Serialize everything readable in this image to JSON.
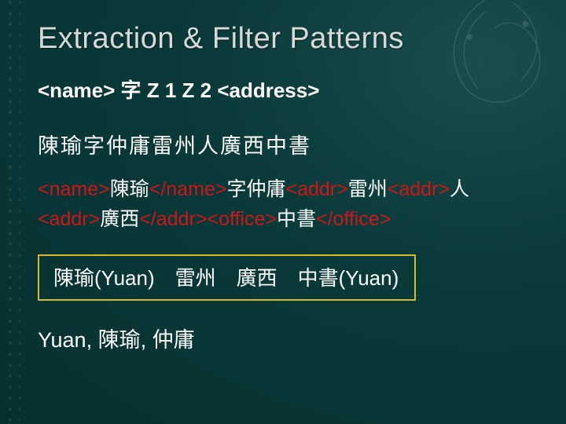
{
  "title": "Extraction & Filter Patterns",
  "pattern": "<name> 字 Z 1 Z 2 <address>",
  "example_source": "陳瑜字仲庸雷州人廣西中書",
  "tagged": {
    "p1_tag": "<name>",
    "p1_txt": "陳瑜",
    "p2_tag": "</name>",
    "p3_txt": "字仲庸",
    "p4_tag": "<addr>",
    "p5_txt": "雷州",
    "p6_tag": "<addr>",
    "p7_txt": "人",
    "p8_tag": "<addr>",
    "p9_txt": "廣西",
    "p10_tag": "</addr><office>",
    "p11_txt": "中書",
    "p12_tag": "</office>"
  },
  "boxed": {
    "c1": "陳瑜(Yuan)",
    "c2": "雷州",
    "c3": "廣西",
    "c4": "中書(Yuan)"
  },
  "footer": "Yuan, 陳瑜, 仲庸"
}
